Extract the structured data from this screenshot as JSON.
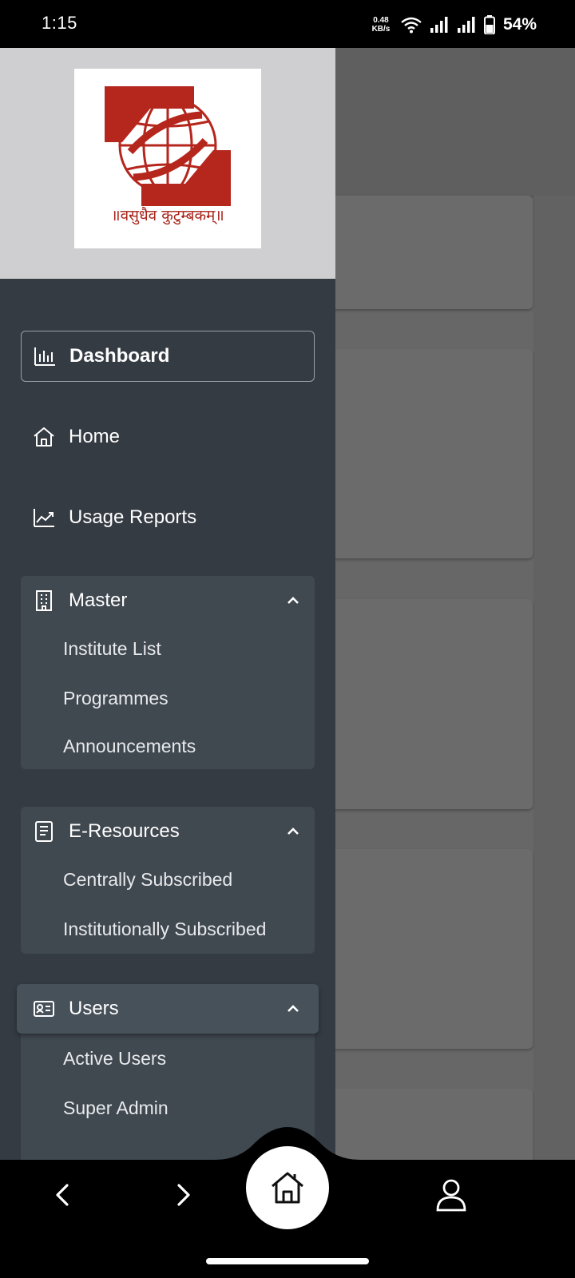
{
  "status_bar": {
    "time": "1:15",
    "net_speed_value": "0.48",
    "net_speed_unit": "KB/s",
    "battery": "54%"
  },
  "logo": {
    "motto": "॥वसुधैव कुटुम्बकम्॥",
    "brand_color": "#a8241a"
  },
  "drawer": {
    "items": [
      {
        "label": "Dashboard",
        "icon": "bar-chart-icon",
        "active": true
      },
      {
        "label": "Home",
        "icon": "home-icon"
      },
      {
        "label": "Usage Reports",
        "icon": "trend-line-icon"
      }
    ],
    "groups": [
      {
        "label": "Master",
        "icon": "building-icon",
        "expanded": true,
        "children": [
          "Institute List",
          "Programmes",
          "Announcements"
        ]
      },
      {
        "label": "E-Resources",
        "icon": "document-icon",
        "expanded": true,
        "children": [
          "Centrally Subscribed",
          "Institutionally Subscribed"
        ]
      },
      {
        "label": "Users",
        "icon": "id-card-icon",
        "expanded": true,
        "children": [
          "Active Users",
          "Super Admin"
        ]
      }
    ]
  },
  "bottom_nav": {
    "items": [
      "back-icon",
      "forward-icon",
      "home-icon",
      "profile-icon"
    ]
  },
  "colors": {
    "drawer_bg": "#353b43",
    "group_bg": "#404850",
    "header_bg": "#cfced0",
    "overlay": "#676767"
  }
}
